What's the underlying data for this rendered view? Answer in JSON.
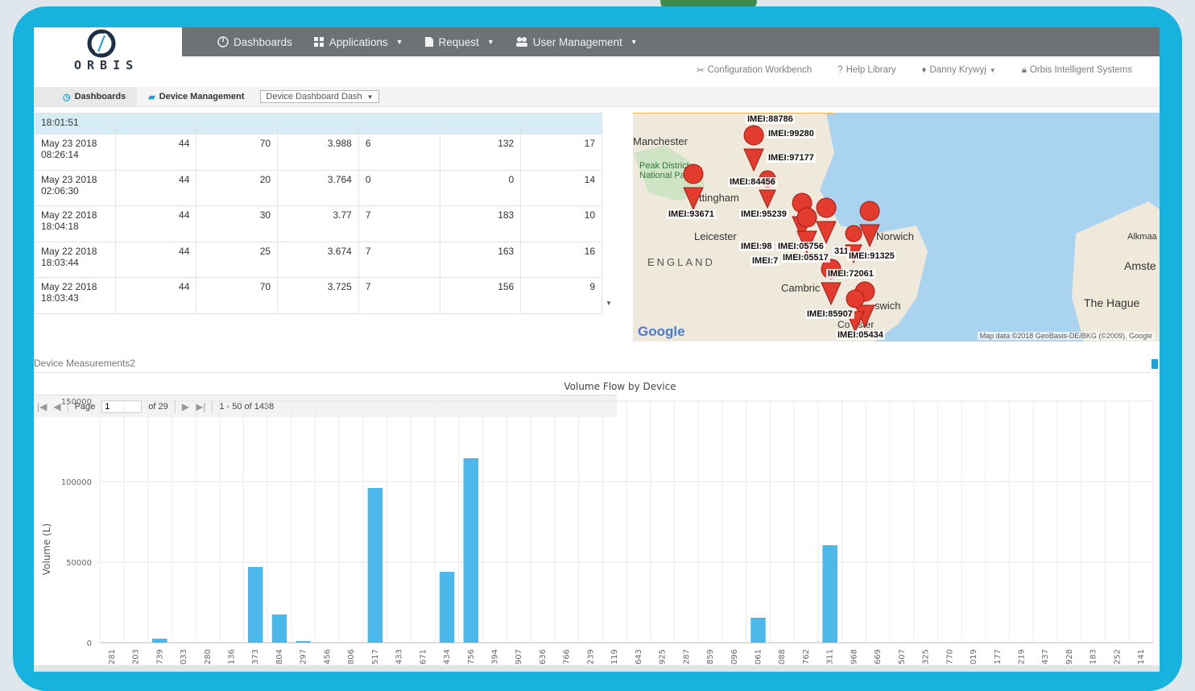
{
  "brand": {
    "logo_text": "ORBIS"
  },
  "topnav": [
    {
      "label": "Dashboards",
      "icon": "dashboard-icon",
      "caret": false
    },
    {
      "label": "Applications",
      "icon": "grid-icon",
      "caret": true
    },
    {
      "label": "Request",
      "icon": "document-icon",
      "caret": true
    },
    {
      "label": "User Management",
      "icon": "users-icon",
      "caret": true
    }
  ],
  "utility": {
    "config": "Configuration Workbench",
    "help": "Help Library",
    "user": "Danny Krywyj",
    "org": "Orbis Intelligent Systems"
  },
  "breadcrumb": {
    "dashboards": "Dashboards",
    "device_mgmt": "Device Management",
    "select": "Device Dashboard Dash"
  },
  "grid": {
    "selected_row_time": "18:01:51",
    "rows": [
      {
        "date": "May 23 2018",
        "time": "08:26:14",
        "c1": "44",
        "c2": "70",
        "c3": "3.988",
        "c4": "6",
        "c5": "132",
        "c6": "17"
      },
      {
        "date": "May 23 2018",
        "time": "02:06:30",
        "c1": "44",
        "c2": "20",
        "c3": "3.764",
        "c4": "0",
        "c5": "0",
        "c6": "14"
      },
      {
        "date": "May 22 2018",
        "time": "18:04:18",
        "c1": "44",
        "c2": "30",
        "c3": "3.77",
        "c4": "7",
        "c5": "183",
        "c6": "10"
      },
      {
        "date": "May 22 2018",
        "time": "18:03:44",
        "c1": "44",
        "c2": "25",
        "c3": "3.674",
        "c4": "7",
        "c5": "163",
        "c6": "16"
      },
      {
        "date": "May 22 2018",
        "time": "18:03:43",
        "c1": "44",
        "c2": "70",
        "c3": "3.725",
        "c4": "7",
        "c5": "156",
        "c6": "9"
      }
    ]
  },
  "pager": {
    "page_label": "Page",
    "page_value": "1",
    "of_pages": "of 29",
    "range": "1 - 50 of 1438"
  },
  "map": {
    "places": {
      "manchester": "Manchester",
      "peak": "Peak District National Park",
      "nottingham": "ttingham",
      "leicester": "Leicester",
      "england": "ENGLAND",
      "norwich": "Norwich",
      "cambridge": "Cambric",
      "ipswich": "swich",
      "colchester": "Co   ester",
      "hague": "The Hague",
      "amsterdam": "Amste",
      "alkmaar": "Alkmaa"
    },
    "markers": [
      "IMEI:88786",
      "IMEI:99280",
      "IMEI:97177",
      "IMEI:84456",
      "IMEI:93671",
      "IMEI:95239",
      "IMEI:98",
      "IMEI:05756",
      "IMEI:7",
      "IMEI:05517",
      "311",
      "IMEI:91325",
      "IMEI:72061",
      "IMEI:85907",
      "IMEI:05434"
    ],
    "google": "Google",
    "attribution": "Map data ©2018 GeoBasis-DE/BKG (©2009), Google"
  },
  "panel": {
    "title": "Device Measurements2"
  },
  "chart_data": {
    "type": "bar",
    "title": "Volume Flow by Device",
    "ylabel": "Volume (L)",
    "xlabel": "",
    "ylim": [
      0,
      150000
    ],
    "yticks": [
      0,
      50000,
      100000,
      150000
    ],
    "bar_color": "#4cb8ea",
    "categories": [
      "281",
      "203",
      "739",
      "033",
      "280",
      "136",
      "373",
      "804",
      "297",
      "456",
      "806",
      "517",
      "433",
      "671",
      "434",
      "756",
      "394",
      "907",
      "636",
      "766",
      "239",
      "119",
      "643",
      "925",
      "287",
      "859",
      "096",
      "061",
      "088",
      "762",
      "311",
      "968",
      "669",
      "507",
      "325",
      "770",
      "019",
      "177",
      "219",
      "437",
      "928",
      "183",
      "252",
      "141"
    ],
    "values": [
      0,
      0,
      2500,
      0,
      0,
      0,
      47000,
      17500,
      1000,
      0,
      0,
      96000,
      0,
      0,
      44000,
      114500,
      0,
      0,
      0,
      0,
      0,
      0,
      0,
      0,
      0,
      0,
      0,
      15500,
      0,
      0,
      60500,
      0,
      0,
      0,
      0,
      0,
      0,
      0,
      0,
      0,
      0,
      0,
      0,
      0
    ]
  },
  "colors": {
    "frame": "#17b3de",
    "nav": "#6d7276",
    "accent": "#1aa1d8",
    "marker": "#e33b2e"
  }
}
